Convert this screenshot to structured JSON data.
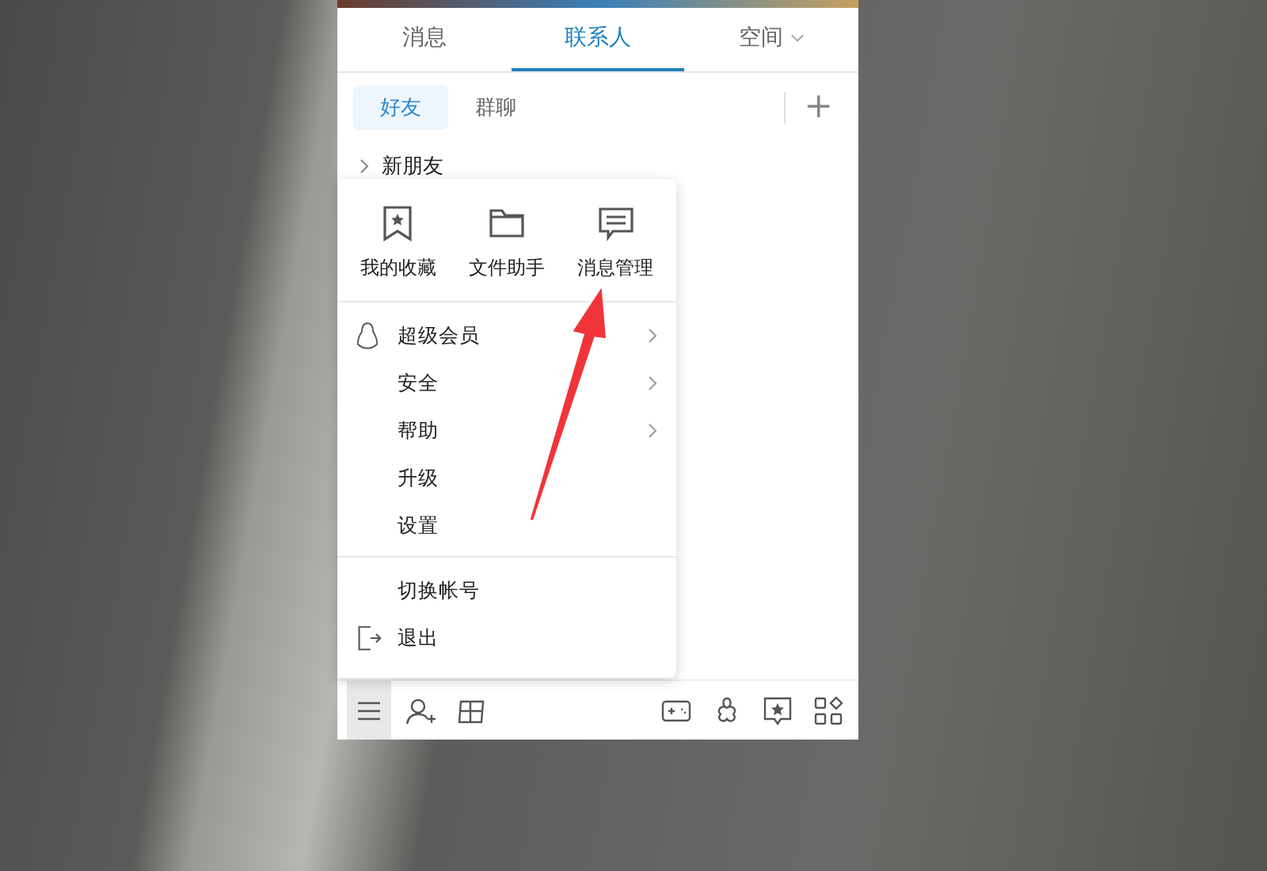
{
  "tabs": [
    {
      "label": "消息",
      "selected": false,
      "dropdown": false
    },
    {
      "label": "联系人",
      "selected": true,
      "dropdown": false
    },
    {
      "label": "空间",
      "selected": false,
      "dropdown": true
    }
  ],
  "subtabs": [
    {
      "label": "好友",
      "selected": true
    },
    {
      "label": "群聊",
      "selected": false
    }
  ],
  "add_button": "+",
  "contacts": [
    {
      "label": "新朋友",
      "expanded": false
    }
  ],
  "main_menu": {
    "quick_actions": [
      {
        "label": "我的收藏",
        "kind": "bookmark"
      },
      {
        "label": "文件助手",
        "kind": "folder"
      },
      {
        "label": "消息管理",
        "kind": "message"
      }
    ],
    "sections": [
      [
        {
          "label": "超级会员",
          "kind": "penguin",
          "submenu": true
        },
        {
          "label": "安全",
          "kind": "none",
          "submenu": true
        },
        {
          "label": "帮助",
          "kind": "none",
          "submenu": true
        },
        {
          "label": "升级",
          "kind": "none",
          "submenu": false
        },
        {
          "label": "设置",
          "kind": "none",
          "submenu": false
        }
      ],
      [
        {
          "label": "切换帐号",
          "kind": "none",
          "submenu": false
        },
        {
          "label": "退出",
          "kind": "exit",
          "submenu": false
        }
      ]
    ]
  },
  "toolbar": {
    "menu_active": true
  }
}
